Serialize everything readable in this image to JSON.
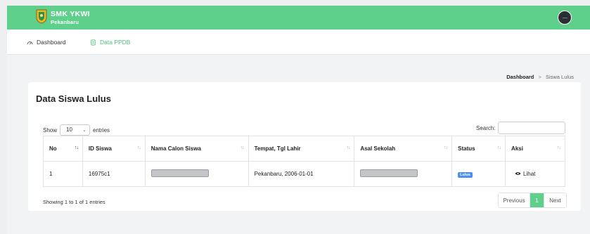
{
  "brand": {
    "title": "SMK YKWI",
    "subtitle": "Pekanbaru"
  },
  "nav": {
    "dashboard": "Dashboard",
    "ppdb": "Data PPDB"
  },
  "breadcrumb": {
    "home": "Dashboard",
    "separator": ">",
    "current": "Siswa Lulus"
  },
  "card": {
    "title": "Data Siswa Lulus"
  },
  "length_menu": {
    "prefix": "Show",
    "value": "10",
    "suffix": "entries"
  },
  "search": {
    "label": "Search:",
    "value": ""
  },
  "table": {
    "headers": [
      "No",
      "ID Siswa",
      "Nama Calon Siswa",
      "Tempat, Tgl Lahir",
      "Asal Sekolah",
      "Status",
      "Aksi"
    ],
    "rows": [
      {
        "no": "1",
        "id": "16975c1",
        "name": "",
        "birth": "Pekanbaru, 2006-01-01",
        "school": "",
        "status": "Lulus",
        "action": "Lihat"
      }
    ]
  },
  "info": "Showing 1 to 1 of 1 entries",
  "pagination": {
    "previous": "Previous",
    "page": "1",
    "next": "Next"
  },
  "colors": {
    "primary": "#5fcf8c",
    "badge": "#4a8ff0",
    "background": "#f2f3f5"
  }
}
